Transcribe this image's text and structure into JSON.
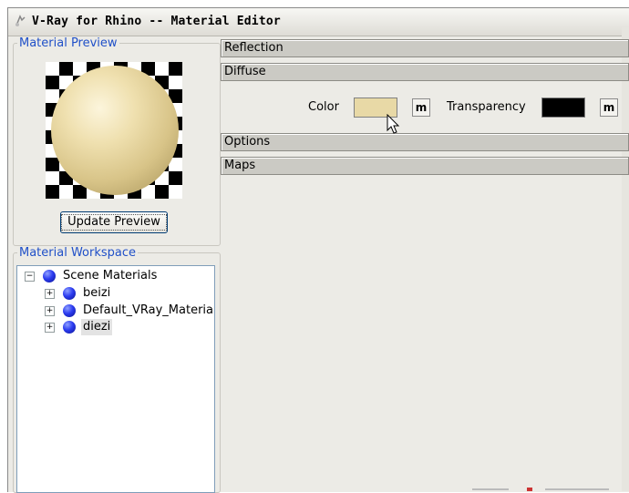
{
  "window": {
    "title": "V-Ray for Rhino -- Material Editor"
  },
  "preview": {
    "legend": "Material Preview",
    "update_button": "Update Preview"
  },
  "workspace": {
    "legend": "Material Workspace",
    "tree": {
      "root": "Scene Materials",
      "children": [
        "beizi",
        "Default_VRay_Materia",
        "diezi"
      ]
    }
  },
  "panels": {
    "reflection": "Reflection",
    "diffuse": "Diffuse",
    "options": "Options",
    "maps": "Maps"
  },
  "diffuse": {
    "color_label": "Color",
    "color_value": "#e8d9a6",
    "m_label": "m",
    "transparency_label": "Transparency",
    "transparency_value": "#000000"
  },
  "colors": {
    "legend_blue": "#2050c8",
    "material_ball_blue": "#2c3cf0"
  },
  "icons": [
    "vray-app-icon",
    "material-sphere-preview",
    "material-ball-icon",
    "expand-plus-icon",
    "collapse-minus-icon",
    "mouse-cursor-icon"
  ]
}
